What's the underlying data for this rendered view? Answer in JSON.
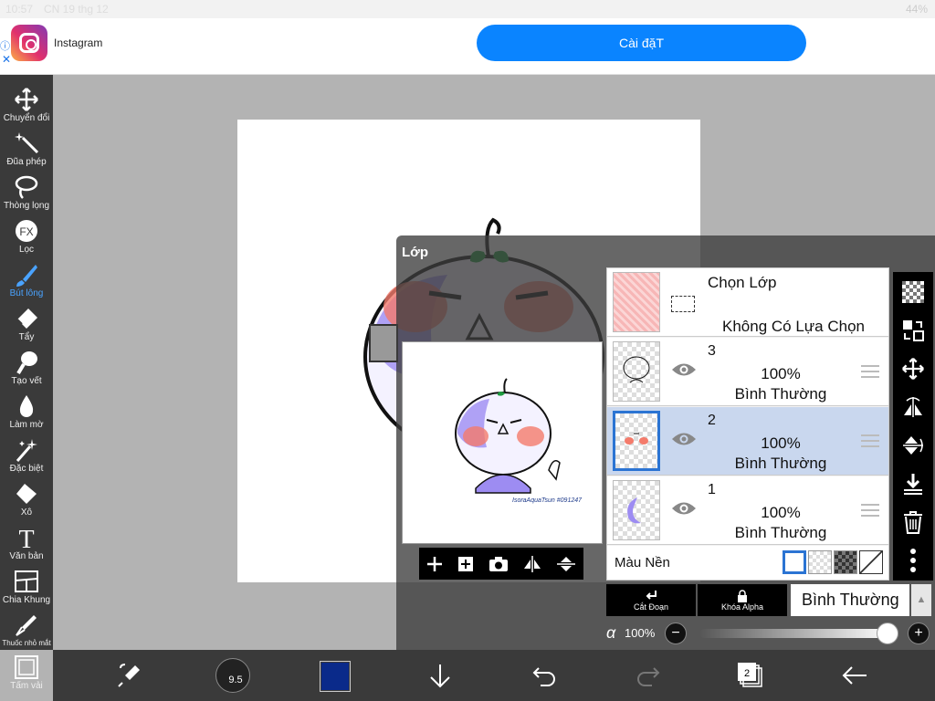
{
  "status_bar": {
    "time": "10:57",
    "date": "CN 19 thg 12",
    "battery": "44%"
  },
  "ad": {
    "app_name": "Instagram",
    "cta": "Cài đặT",
    "info": "ⓘ",
    "close": "✕"
  },
  "tools": [
    {
      "label": "Chuyển đổi",
      "icon": "move-icon"
    },
    {
      "label": "Đũa phép",
      "icon": "magic-wand-icon"
    },
    {
      "label": "Thòng lọng",
      "icon": "lasso-icon"
    },
    {
      "label": "Lọc",
      "icon": "fx-icon"
    },
    {
      "label": "Bút lông",
      "icon": "brush-icon"
    },
    {
      "label": "Tẩy",
      "icon": "eraser-icon"
    },
    {
      "label": "Tạo vết",
      "icon": "smudge-icon"
    },
    {
      "label": "Làm mờ",
      "icon": "blur-icon"
    },
    {
      "label": "Đặc biệt",
      "icon": "special-icon"
    },
    {
      "label": "Xô",
      "icon": "bucket-icon"
    },
    {
      "label": "Văn bản",
      "icon": "text-icon"
    },
    {
      "label": "Chia Khung",
      "icon": "frame-divide-icon"
    },
    {
      "label": "Thuốc nhỏ mắt",
      "icon": "eyedropper-icon"
    },
    {
      "label": "Tấm vải",
      "icon": "canvas-icon"
    }
  ],
  "layer_panel": {
    "title": "Lớp",
    "select_layer": {
      "label": "Chọn Lớp",
      "status": "Không Có Lựa Chọn"
    },
    "layers": [
      {
        "name": "3",
        "opacity": "100%",
        "mode": "Bình Thường",
        "selected": false
      },
      {
        "name": "2",
        "opacity": "100%",
        "mode": "Bình Thường",
        "selected": true
      },
      {
        "name": "1",
        "opacity": "100%",
        "mode": "Bình Thường",
        "selected": false
      }
    ],
    "background_label": "Màu Nền",
    "clipping_label": "Cắt Đoạn",
    "alpha_lock_label": "Khóa Alpha",
    "blend_mode": "Bình Thường",
    "alpha_symbol": "α",
    "opacity": "100%",
    "opacity_fraction": 1.0,
    "minus": "−",
    "plus": "+",
    "preview_caption": "IsoraAquaTsun #091247"
  },
  "bottom_bar": {
    "brush_size": "9.5",
    "layer_count": "2",
    "color": "#0a2a8a"
  },
  "colors": {
    "accent": "#0a84ff",
    "selected_layer": "#c9d7ee",
    "toolbar": "#3a3a3a"
  }
}
